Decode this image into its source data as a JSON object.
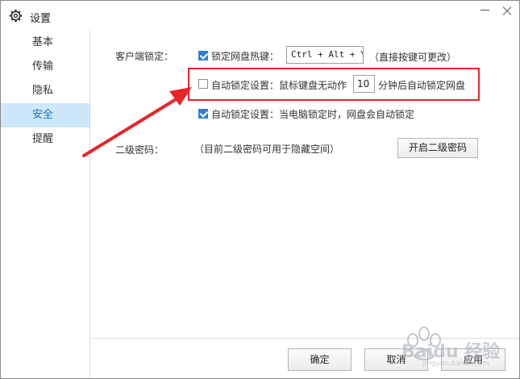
{
  "window": {
    "title": "设置",
    "title_icon": "gear-icon"
  },
  "sidebar": {
    "items": [
      {
        "label": "基本"
      },
      {
        "label": "传输"
      },
      {
        "label": "隐私"
      },
      {
        "label": "安全",
        "active": true
      },
      {
        "label": "提醒"
      }
    ]
  },
  "client_lock": {
    "section_label": "客户端锁定：",
    "hotkey": {
      "checked": true,
      "label": "锁定网盘热键：",
      "value": "Ctrl + Alt + Y",
      "hint": "（直接按键可更改）"
    },
    "idle_lock": {
      "checked": false,
      "label": "自动锁定设置：鼠标键盘无动作",
      "minutes": "10",
      "suffix": "分钟后自动锁定网盘"
    },
    "pc_lock": {
      "checked": true,
      "label": "自动锁定设置：当电脑锁定时，网盘会自动锁定"
    }
  },
  "second_password": {
    "label": "二级密码：",
    "hint": "（目前二级密码可用于隐藏空间）",
    "button": "开启二级密码"
  },
  "footer": {
    "ok": "确定",
    "cancel": "取消",
    "apply": "应用"
  },
  "watermark": {
    "text": "Baidu 经验",
    "url": "jingyan.baidu.com"
  },
  "colors": {
    "accent": "#2f7fd5",
    "active_nav_bg": "#cde8fa",
    "highlight": "#e8242b"
  }
}
